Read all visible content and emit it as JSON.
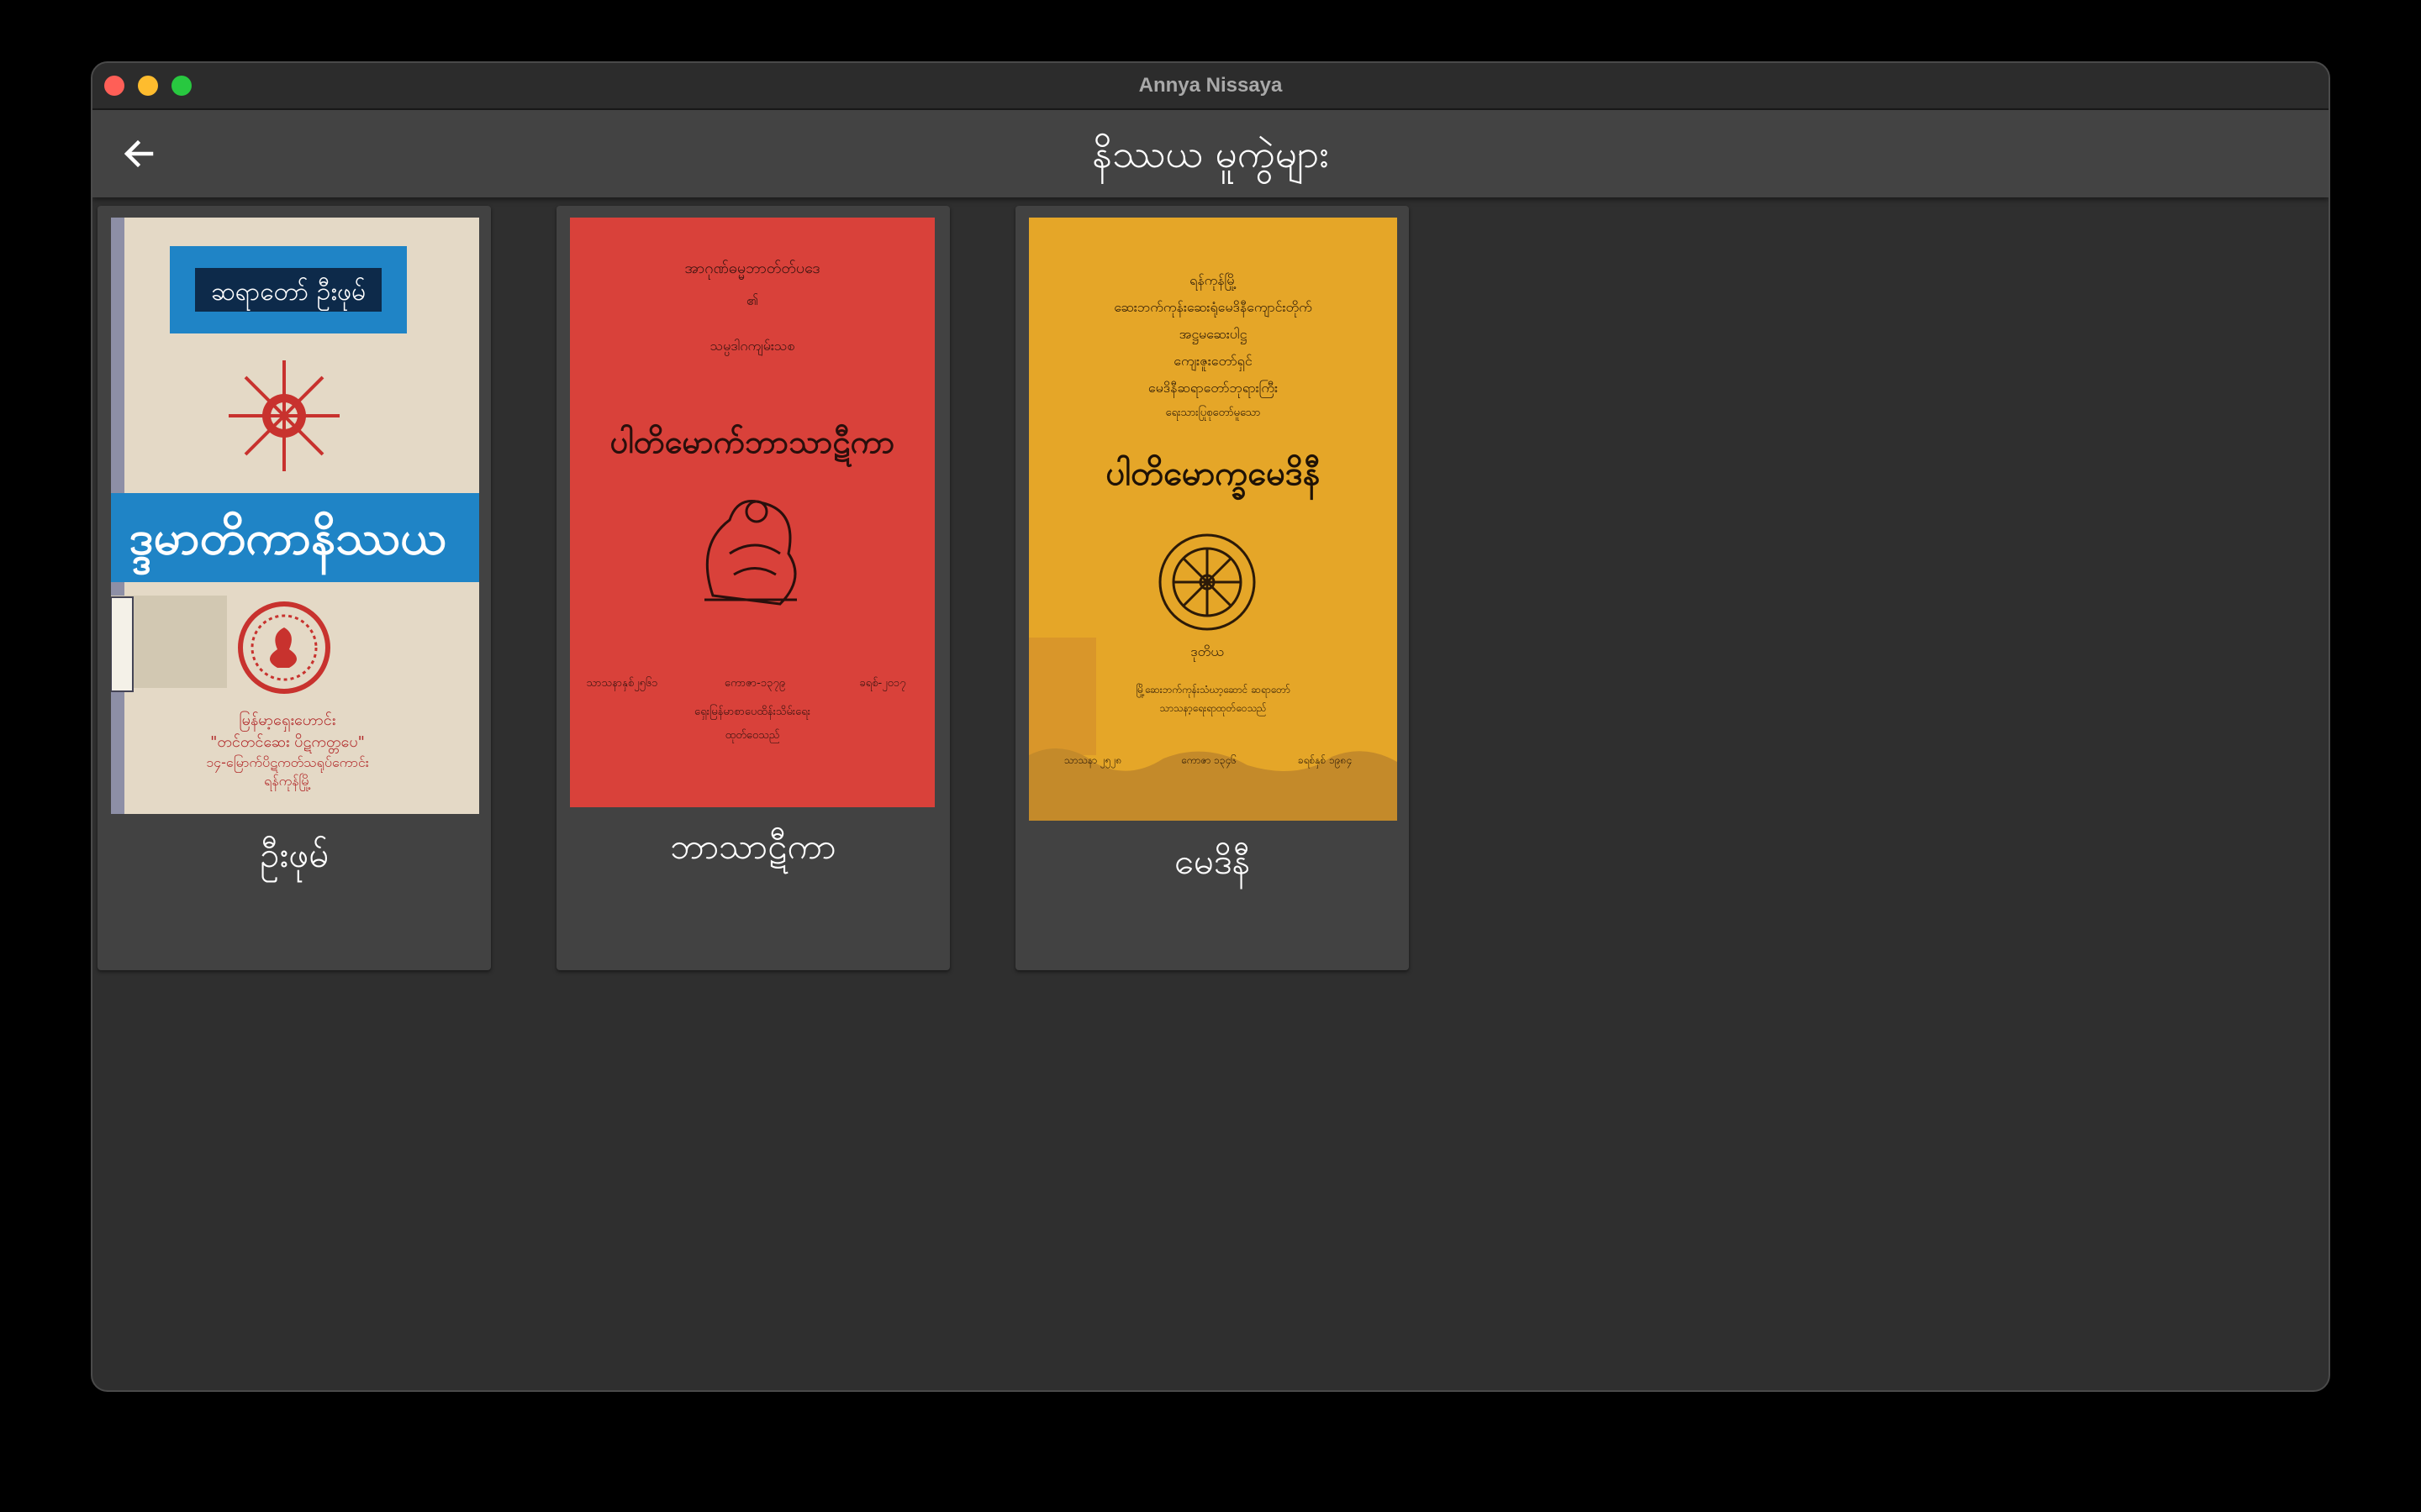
{
  "window": {
    "title": "Annya Nissaya"
  },
  "appbar": {
    "title": "နိဿယ မူကွဲများ",
    "back_icon": "arrow-left-icon"
  },
  "books": [
    {
      "label": "ဦးဖုမ်",
      "cover": {
        "banner_top": "ဆရာတော် ဦးဖုမ်",
        "banner_mid": "ဒ္ဒမာတိကာနိဿယ",
        "footer_1": "မြန်မာ့ရှေးဟောင်း",
        "footer_2": "\"တင်တင်ဆေး ပိဋကတ္တပေ\"",
        "footer_3": "၁၄-မြောက်ပိဋကတ်သရုပ်ကောင်း",
        "footer_4": "ရန်ကုန်မြို့",
        "colors": {
          "paper": "#e4d9c6",
          "blue": "#1f84c6",
          "red": "#c8322e"
        }
      }
    },
    {
      "label": "ဘာသာဋီကာ",
      "cover": {
        "line_1": "အာဂုဏ်ဓမ္မဘာတ်တ်ပဒေ",
        "line_2": "၏",
        "line_3": "သမ္ပဒါဂကျမ်းသစ",
        "title": "ပါတိမောက်ဘာသာဋီကာ",
        "bottom_1": "သာသနာနှစ်၂၅၆၁",
        "bottom_2": "ကောဇာ-၁၃၇၉",
        "bottom_3": "ခရစ်-၂၀၁၇",
        "bottom_4": "ရှေးမြန်မာစာပေထိန်းသိမ်းရေး",
        "bottom_5": "ထုတ်ဝေသည်",
        "colors": {
          "paper": "#d9413a",
          "ink": "#3a1410"
        }
      }
    },
    {
      "label": "မေဒိနီ",
      "cover": {
        "line_1": "ရန်ကုန်မြို့",
        "line_2": "ဆေးဘက်ကုန်းဆေးရုံမေဒိနီကျောင်းတိုက်",
        "line_3": "အဋ္ဌမဆေးပါဋ္ဌ",
        "line_4": "ကျေးဇူးတော်ရှင်",
        "line_5": "မေဒိနီဆရာတော်ဘုရားကြီး",
        "line_6": "ရေးသားပြုစုတော်မူသော",
        "title": "ပါတိမောက္ခမေဒိနီ",
        "edition": "ဒုတိယ",
        "pub_1": "မြို့ဆေးဘက်ကုန်းသံဃာ့ဆောင် ဆရာတော်",
        "pub_2": "သာသနာ့ရေးရာထုတ်ဝေသည်",
        "bottom_1": "သာသနာ ၂၅၂၈",
        "bottom_2": "ကောဇာ ၁၃၄၆",
        "bottom_3": "ခရစ်နှစ် ၁၉၈၄",
        "colors": {
          "paper": "#e5a628",
          "ink": "#2c1a08"
        }
      }
    }
  ]
}
